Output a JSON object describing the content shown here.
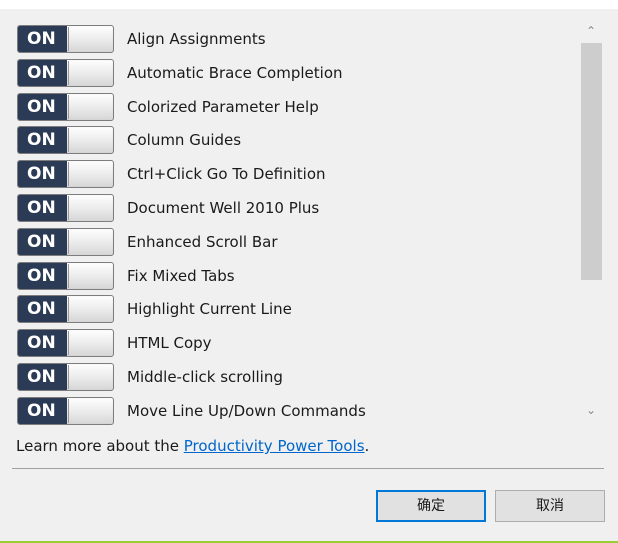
{
  "features": [
    {
      "label": "Align Assignments",
      "state": "ON"
    },
    {
      "label": "Automatic Brace Completion",
      "state": "ON"
    },
    {
      "label": "Colorized Parameter Help",
      "state": "ON"
    },
    {
      "label": "Column Guides",
      "state": "ON"
    },
    {
      "label": "Ctrl+Click Go To Definition",
      "state": "ON"
    },
    {
      "label": "Document Well 2010 Plus",
      "state": "ON"
    },
    {
      "label": "Enhanced Scroll Bar",
      "state": "ON"
    },
    {
      "label": "Fix Mixed Tabs",
      "state": "ON"
    },
    {
      "label": "Highlight Current Line",
      "state": "ON"
    },
    {
      "label": "HTML Copy",
      "state": "ON"
    },
    {
      "label": "Middle-click scrolling",
      "state": "ON"
    },
    {
      "label": "Move Line Up/Down Commands",
      "state": "ON"
    }
  ],
  "scrollbar": {
    "up_icon": "⌃",
    "down_icon": "⌄"
  },
  "footer": {
    "learn_prefix": "Learn more about the ",
    "learn_link": "Productivity Power Tools",
    "learn_suffix": "."
  },
  "buttons": {
    "ok": "确定",
    "cancel": "取消"
  },
  "colors": {
    "toggle_on": "#2b3a55",
    "link": "#0066cc",
    "primary_border": "#0078d7",
    "accent_line": "#9acd32"
  }
}
